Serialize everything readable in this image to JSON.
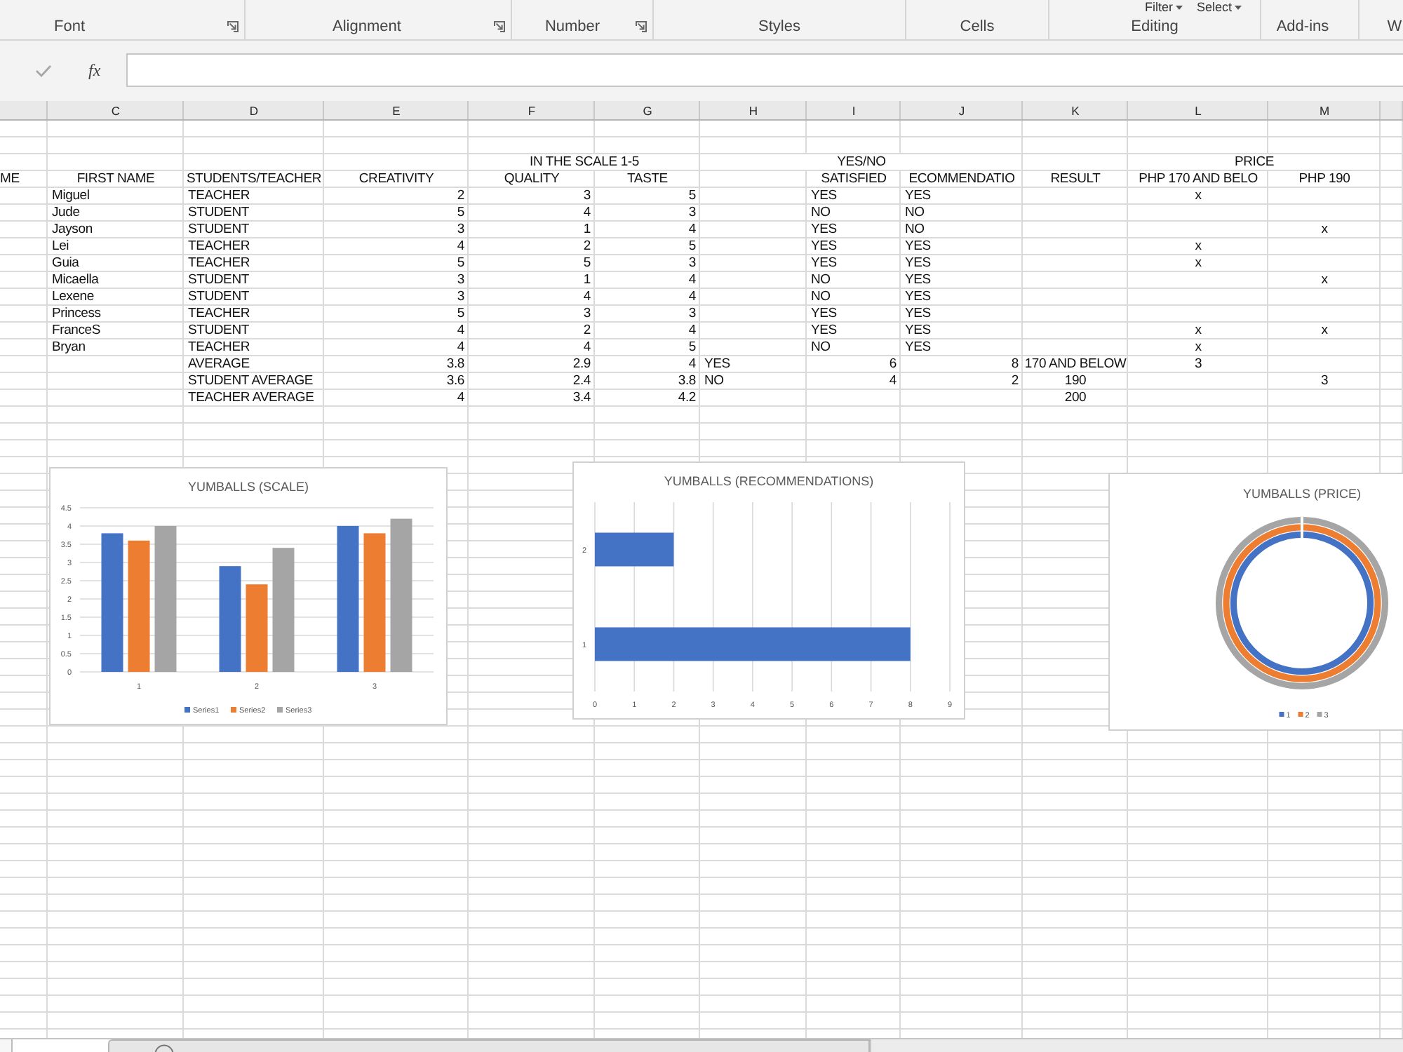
{
  "ribbon": {
    "groups": [
      {
        "label": "Font",
        "launcher": true
      },
      {
        "label": "Alignment",
        "launcher": true
      },
      {
        "label": "Number",
        "launcher": true
      },
      {
        "label": "Styles",
        "launcher": false
      },
      {
        "label": "Cells",
        "launcher": false
      },
      {
        "label": "Editing",
        "launcher": false,
        "buttons": [
          "Filter",
          "Select"
        ]
      },
      {
        "label": "Add-ins",
        "launcher": false
      },
      {
        "label": "W",
        "launcher": false
      }
    ]
  },
  "formula_bar": {
    "function_button": "fx"
  },
  "sheet": {
    "columns": [
      "",
      "C",
      "D",
      "E",
      "F",
      "G",
      "H",
      "I",
      "J",
      "K",
      "L",
      "M"
    ],
    "rows": [
      {
        "kind": "group_heading",
        "cells": [
          "",
          "",
          "",
          "",
          "IN THE SCALE 1-5",
          "",
          "YES/NO",
          "",
          "",
          "",
          "PRICE",
          ""
        ]
      },
      {
        "kind": "heading",
        "cells": [
          "ME",
          "FIRST NAME",
          "STUDENTS/TEACHER",
          "CREATIVITY",
          "QUALITY",
          "TASTE",
          "",
          "SATISFIED",
          "ECOMMENDATIO",
          "RESULT",
          "PHP 170 AND BELO",
          "PHP 190"
        ]
      },
      {
        "kind": "data",
        "cells": [
          "",
          "Miguel",
          "TEACHER",
          "2",
          "3",
          "5",
          "",
          "YES",
          "YES",
          "",
          "x",
          ""
        ]
      },
      {
        "kind": "data",
        "cells": [
          "",
          "Jude",
          "STUDENT",
          "5",
          "4",
          "3",
          "",
          "NO",
          "NO",
          "",
          "",
          ""
        ]
      },
      {
        "kind": "data",
        "cells": [
          "",
          "Jayson",
          "STUDENT",
          "3",
          "1",
          "4",
          "",
          "YES",
          "NO",
          "",
          "",
          "x"
        ]
      },
      {
        "kind": "data",
        "cells": [
          "",
          "Lei",
          "TEACHER",
          "4",
          "2",
          "5",
          "",
          "YES",
          "YES",
          "",
          "x",
          ""
        ]
      },
      {
        "kind": "data",
        "cells": [
          "",
          "Guia",
          "TEACHER",
          "5",
          "5",
          "3",
          "",
          "YES",
          "YES",
          "",
          "x",
          ""
        ]
      },
      {
        "kind": "data",
        "cells": [
          "",
          "Micaella",
          "STUDENT",
          "3",
          "1",
          "4",
          "",
          "NO",
          "YES",
          "",
          "",
          "x"
        ]
      },
      {
        "kind": "data",
        "cells": [
          "",
          "Lexene",
          "STUDENT",
          "3",
          "4",
          "4",
          "",
          "NO",
          "YES",
          "",
          "",
          ""
        ]
      },
      {
        "kind": "data",
        "cells": [
          "",
          "Princess",
          "TEACHER",
          "5",
          "3",
          "3",
          "",
          "YES",
          "YES",
          "",
          "",
          ""
        ]
      },
      {
        "kind": "data",
        "cells": [
          "",
          "FranceS",
          "STUDENT",
          "4",
          "2",
          "4",
          "",
          "YES",
          "YES",
          "",
          "x",
          "x"
        ]
      },
      {
        "kind": "data",
        "cells": [
          "",
          "Bryan",
          "TEACHER",
          "4",
          "4",
          "5",
          "",
          "NO",
          "YES",
          "",
          "x",
          ""
        ]
      },
      {
        "kind": "summary",
        "cells": [
          "",
          "",
          "AVERAGE",
          "3.8",
          "2.9",
          "4",
          "YES",
          "6",
          "8",
          "170 AND BELOW",
          "3",
          ""
        ]
      },
      {
        "kind": "summary",
        "cells": [
          "",
          "",
          "STUDENT AVERAGE",
          "3.6",
          "2.4",
          "3.8",
          "NO",
          "4",
          "2",
          "190",
          "",
          "3"
        ]
      },
      {
        "kind": "summary",
        "cells": [
          "",
          "",
          "TEACHER AVERAGE",
          "4",
          "3.4",
          "4.2",
          "",
          "",
          "",
          "200",
          "",
          ""
        ]
      }
    ]
  },
  "scale_chart": {
    "chart_data": {
      "type": "bar",
      "title": "YUMBALLS (SCALE)",
      "categories": [
        "1",
        "2",
        "3"
      ],
      "series": [
        {
          "name": "Series1",
          "color": "#4472c4",
          "values": [
            3.8,
            2.9,
            4
          ]
        },
        {
          "name": "Series2",
          "color": "#ed7d31",
          "values": [
            3.6,
            2.4,
            3.8
          ]
        },
        {
          "name": "Series3",
          "color": "#a5a5a5",
          "values": [
            4,
            3.4,
            4.2
          ]
        }
      ],
      "ylim": [
        0,
        4.5
      ],
      "yticks": [
        0,
        0.5,
        1,
        1.5,
        2,
        2.5,
        3,
        3.5,
        4,
        4.5
      ],
      "grid": true,
      "legend": "bottom"
    }
  },
  "recommendations_chart": {
    "chart_data": {
      "type": "bar",
      "orientation": "horizontal",
      "title": "YUMBALLS (RECOMMENDATIONS)",
      "categories": [
        "2",
        "1"
      ],
      "series": [
        {
          "color": "#4472c4",
          "values": [
            2,
            8
          ]
        }
      ],
      "xlim": [
        0,
        9
      ],
      "xticks": [
        0,
        1,
        2,
        3,
        4,
        5,
        6,
        7,
        8,
        9
      ],
      "grid": true
    }
  },
  "price_chart": {
    "title": "YUMBALLS (PRICE)",
    "legend": [
      {
        "label": "1",
        "color": "#4472c4"
      },
      {
        "label": "2",
        "color": "#ed7d31"
      },
      {
        "label": "3",
        "color": "#a5a5a5"
      }
    ]
  }
}
